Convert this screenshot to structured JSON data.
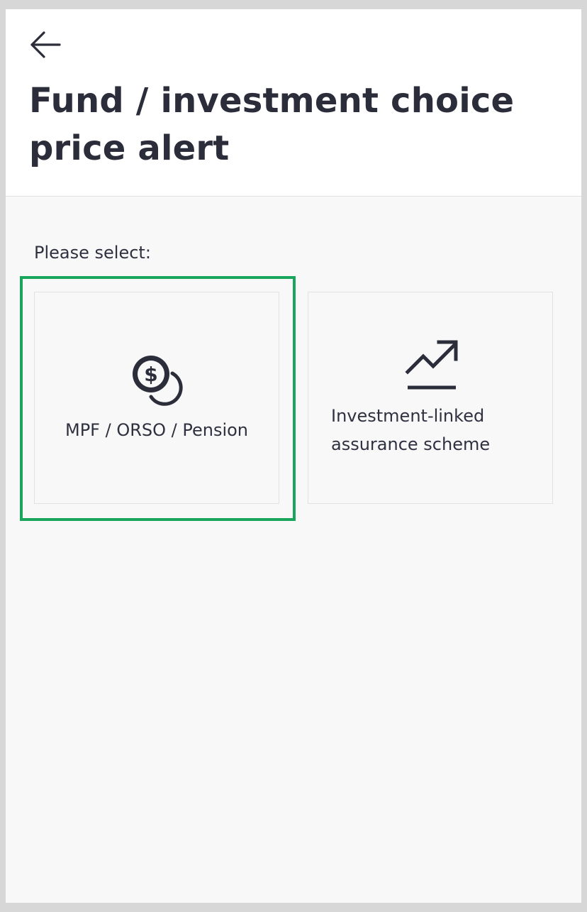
{
  "header": {
    "back_icon": "arrow-left-icon",
    "title": "Fund / investment choice price alert"
  },
  "content": {
    "prompt": "Please select:",
    "options": [
      {
        "label": "MPF / ORSO / Pension",
        "icon": "coins-dollar-icon",
        "selected": true
      },
      {
        "label": "Investment-linked assurance scheme",
        "icon": "trending-up-icon",
        "selected": false
      }
    ]
  },
  "colors": {
    "text": "#2b2d3a",
    "background": "#f8f8f8",
    "header_background": "#ffffff",
    "selection_border": "#1aa55c",
    "card_border": "#e2e2e2"
  }
}
